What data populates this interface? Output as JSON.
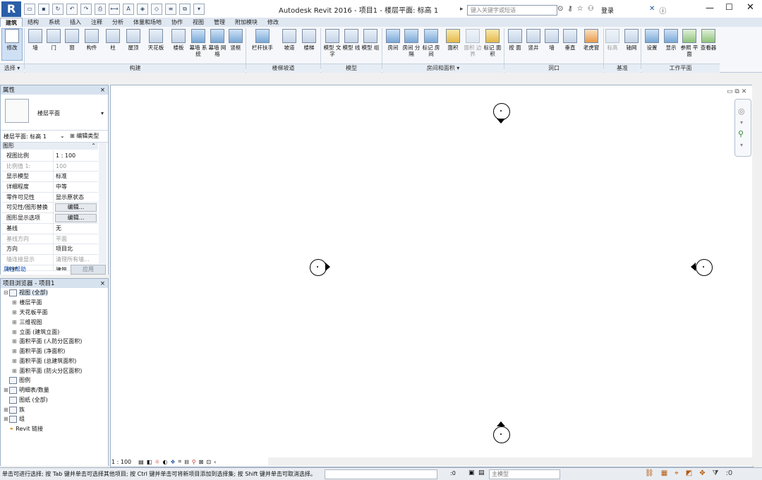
{
  "window": {
    "title": "Autodesk Revit 2016 -      项目1 - 楼层平面: 标高 1",
    "app_menu": "R",
    "search_placeholder": "键入关键字或短语",
    "login_label": "登录",
    "minimize": "—",
    "maximize": "☐",
    "close": "✕"
  },
  "tabs": [
    "建筑",
    "结构",
    "系统",
    "插入",
    "注释",
    "分析",
    "体量和场地",
    "协作",
    "视图",
    "管理",
    "附加模块",
    "修改"
  ],
  "ribbon": {
    "modify": "修改",
    "select_label": "选择 ▾",
    "groups": {
      "build": "构建",
      "stair_ramp": "楼梯坡道",
      "model": "模型",
      "room_area": "房间和面积 ▾",
      "opening": "洞口",
      "datum": "基准",
      "work_plane": "工作平面"
    },
    "buttons": [
      {
        "label": "墙",
        "icon": "wall-icon"
      },
      {
        "label": "门",
        "icon": "door-icon"
      },
      {
        "label": "窗",
        "icon": "window-icon"
      },
      {
        "label": "构件",
        "icon": "component-icon"
      },
      {
        "label": "柱",
        "icon": "column-icon"
      },
      {
        "label": "屋顶",
        "icon": "roof-icon"
      },
      {
        "label": "天花板",
        "icon": "ceiling-icon"
      },
      {
        "label": "楼板",
        "icon": "floor-icon"
      },
      {
        "label": "幕墙 系统",
        "icon": "curtain-system-icon"
      },
      {
        "label": "幕墙 网格",
        "icon": "curtain-grid-icon"
      },
      {
        "label": "竖梃",
        "icon": "mullion-icon"
      },
      {
        "label": "栏杆扶手",
        "icon": "railing-icon"
      },
      {
        "label": "坡道",
        "icon": "ramp-icon"
      },
      {
        "label": "楼梯",
        "icon": "stair-icon"
      },
      {
        "label": "模型 文字",
        "icon": "model-text-icon"
      },
      {
        "label": "模型 线",
        "icon": "model-line-icon"
      },
      {
        "label": "模型 组",
        "icon": "model-group-icon"
      },
      {
        "label": "房间",
        "icon": "room-icon"
      },
      {
        "label": "房间 分隔",
        "icon": "room-separator-icon"
      },
      {
        "label": "标记 房间",
        "icon": "tag-room-icon"
      },
      {
        "label": "面积",
        "icon": "area-icon"
      },
      {
        "label": "面积 边界",
        "icon": "area-boundary-icon"
      },
      {
        "label": "标记 面积",
        "icon": "tag-area-icon"
      },
      {
        "label": "按 面",
        "icon": "by-face-icon"
      },
      {
        "label": "竖井",
        "icon": "shaft-icon"
      },
      {
        "label": "墙",
        "icon": "wall-opening-icon"
      },
      {
        "label": "垂直",
        "icon": "vertical-opening-icon"
      },
      {
        "label": "老虎窗",
        "icon": "dormer-icon"
      },
      {
        "label": "标高",
        "icon": "level-icon"
      },
      {
        "label": "轴网",
        "icon": "grid-icon"
      },
      {
        "label": "设置",
        "icon": "set-icon"
      },
      {
        "label": "显示",
        "icon": "show-icon"
      },
      {
        "label": "参照 平面",
        "icon": "ref-plane-icon"
      },
      {
        "label": "查看器",
        "icon": "viewer-icon"
      }
    ]
  },
  "properties": {
    "title": "属性",
    "close": "×",
    "type_name": "楼层平面",
    "instance": "楼层平面: 标高 1",
    "edit_type": "编辑类型",
    "category": "图形",
    "rows": [
      {
        "name": "视图比例",
        "value": "1 : 100",
        "dim": false
      },
      {
        "name": "比例值 1:",
        "value": "100",
        "dim": true
      },
      {
        "name": "显示模型",
        "value": "标准",
        "dim": false
      },
      {
        "name": "详细程度",
        "value": "中等",
        "dim": false
      },
      {
        "name": "零件可见性",
        "value": "显示原状态",
        "dim": false
      },
      {
        "name": "可见性/图形替换",
        "value": "编辑...",
        "dim": false,
        "button": true
      },
      {
        "name": "图形显示选项",
        "value": "编辑...",
        "dim": false,
        "button": true
      },
      {
        "name": "基线",
        "value": "无",
        "dim": false
      },
      {
        "name": "基线方向",
        "value": "平面",
        "dim": true
      },
      {
        "name": "方向",
        "value": "项目北",
        "dim": false
      },
      {
        "name": "墙连接显示",
        "value": "清理所有墙...",
        "dim": true
      },
      {
        "name": "规程",
        "value": "建筑",
        "dim": false
      }
    ],
    "help": "属性帮助",
    "apply": "应用"
  },
  "browser": {
    "title": "项目浏览器 - 项目1",
    "close": "×",
    "nodes": [
      {
        "label": "视图 (全部)",
        "level": 0,
        "expander": "⊟",
        "icon": "views-icon"
      },
      {
        "label": "楼层平面",
        "level": 1,
        "expander": "⊞"
      },
      {
        "label": "天花板平面",
        "level": 1,
        "expander": "⊞"
      },
      {
        "label": "三维视图",
        "level": 1,
        "expander": "⊞"
      },
      {
        "label": "立面 (建筑立面)",
        "level": 1,
        "expander": "⊞"
      },
      {
        "label": "面积平面 (人防分区面积)",
        "level": 1,
        "expander": "⊞"
      },
      {
        "label": "面积平面 (净面积)",
        "level": 1,
        "expander": "⊞"
      },
      {
        "label": "面积平面 (总建筑面积)",
        "level": 1,
        "expander": "⊞"
      },
      {
        "label": "面积平面 (防火分区面积)",
        "level": 1,
        "expander": "⊞"
      },
      {
        "label": "图例",
        "level": 0,
        "expander": "",
        "icon": "legend-icon"
      },
      {
        "label": "明细表/数量",
        "level": 0,
        "expander": "⊞",
        "icon": "schedule-icon"
      },
      {
        "label": "图纸 (全部)",
        "level": 0,
        "expander": "",
        "icon": "sheets-icon"
      },
      {
        "label": "族",
        "level": 0,
        "expander": "⊞",
        "icon": "families-icon"
      },
      {
        "label": "组",
        "level": 0,
        "expander": "⊞",
        "icon": "groups-icon"
      },
      {
        "label": "Revit 链接",
        "level": 0,
        "expander": "",
        "icon": "revit-link-icon"
      }
    ]
  },
  "view_control": {
    "scale": "1 : 100"
  },
  "status": {
    "text": "单击可进行选择; 按 Tab 键并单击可选择其他项目; 按 Ctrl 键并单击可将新项目添加到选择集; 按 Shift 键并单击可取消选择。",
    "coord": ":0",
    "model": "主模型",
    "filter_count": ":0"
  },
  "colors": {
    "accent": "#2a5fa8",
    "ribbon_bg": "#f5f7fa",
    "panel_header": "#d7e2ef"
  }
}
